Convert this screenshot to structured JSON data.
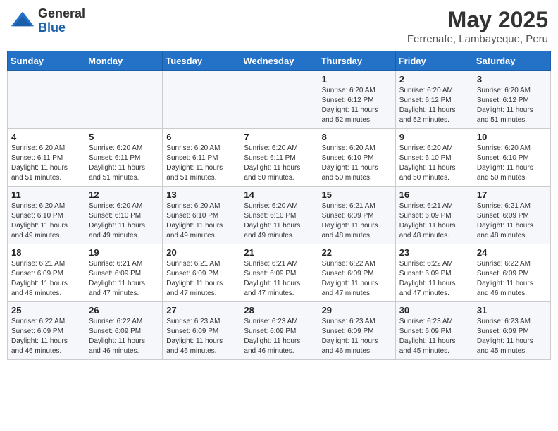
{
  "header": {
    "logo_general": "General",
    "logo_blue": "Blue",
    "month": "May 2025",
    "location": "Ferrenafe, Lambayeque, Peru"
  },
  "weekdays": [
    "Sunday",
    "Monday",
    "Tuesday",
    "Wednesday",
    "Thursday",
    "Friday",
    "Saturday"
  ],
  "weeks": [
    [
      {
        "day": "",
        "info": ""
      },
      {
        "day": "",
        "info": ""
      },
      {
        "day": "",
        "info": ""
      },
      {
        "day": "",
        "info": ""
      },
      {
        "day": "1",
        "info": "Sunrise: 6:20 AM\nSunset: 6:12 PM\nDaylight: 11 hours\nand 52 minutes."
      },
      {
        "day": "2",
        "info": "Sunrise: 6:20 AM\nSunset: 6:12 PM\nDaylight: 11 hours\nand 52 minutes."
      },
      {
        "day": "3",
        "info": "Sunrise: 6:20 AM\nSunset: 6:12 PM\nDaylight: 11 hours\nand 51 minutes."
      }
    ],
    [
      {
        "day": "4",
        "info": "Sunrise: 6:20 AM\nSunset: 6:11 PM\nDaylight: 11 hours\nand 51 minutes."
      },
      {
        "day": "5",
        "info": "Sunrise: 6:20 AM\nSunset: 6:11 PM\nDaylight: 11 hours\nand 51 minutes."
      },
      {
        "day": "6",
        "info": "Sunrise: 6:20 AM\nSunset: 6:11 PM\nDaylight: 11 hours\nand 51 minutes."
      },
      {
        "day": "7",
        "info": "Sunrise: 6:20 AM\nSunset: 6:11 PM\nDaylight: 11 hours\nand 50 minutes."
      },
      {
        "day": "8",
        "info": "Sunrise: 6:20 AM\nSunset: 6:10 PM\nDaylight: 11 hours\nand 50 minutes."
      },
      {
        "day": "9",
        "info": "Sunrise: 6:20 AM\nSunset: 6:10 PM\nDaylight: 11 hours\nand 50 minutes."
      },
      {
        "day": "10",
        "info": "Sunrise: 6:20 AM\nSunset: 6:10 PM\nDaylight: 11 hours\nand 50 minutes."
      }
    ],
    [
      {
        "day": "11",
        "info": "Sunrise: 6:20 AM\nSunset: 6:10 PM\nDaylight: 11 hours\nand 49 minutes."
      },
      {
        "day": "12",
        "info": "Sunrise: 6:20 AM\nSunset: 6:10 PM\nDaylight: 11 hours\nand 49 minutes."
      },
      {
        "day": "13",
        "info": "Sunrise: 6:20 AM\nSunset: 6:10 PM\nDaylight: 11 hours\nand 49 minutes."
      },
      {
        "day": "14",
        "info": "Sunrise: 6:20 AM\nSunset: 6:10 PM\nDaylight: 11 hours\nand 49 minutes."
      },
      {
        "day": "15",
        "info": "Sunrise: 6:21 AM\nSunset: 6:09 PM\nDaylight: 11 hours\nand 48 minutes."
      },
      {
        "day": "16",
        "info": "Sunrise: 6:21 AM\nSunset: 6:09 PM\nDaylight: 11 hours\nand 48 minutes."
      },
      {
        "day": "17",
        "info": "Sunrise: 6:21 AM\nSunset: 6:09 PM\nDaylight: 11 hours\nand 48 minutes."
      }
    ],
    [
      {
        "day": "18",
        "info": "Sunrise: 6:21 AM\nSunset: 6:09 PM\nDaylight: 11 hours\nand 48 minutes."
      },
      {
        "day": "19",
        "info": "Sunrise: 6:21 AM\nSunset: 6:09 PM\nDaylight: 11 hours\nand 47 minutes."
      },
      {
        "day": "20",
        "info": "Sunrise: 6:21 AM\nSunset: 6:09 PM\nDaylight: 11 hours\nand 47 minutes."
      },
      {
        "day": "21",
        "info": "Sunrise: 6:21 AM\nSunset: 6:09 PM\nDaylight: 11 hours\nand 47 minutes."
      },
      {
        "day": "22",
        "info": "Sunrise: 6:22 AM\nSunset: 6:09 PM\nDaylight: 11 hours\nand 47 minutes."
      },
      {
        "day": "23",
        "info": "Sunrise: 6:22 AM\nSunset: 6:09 PM\nDaylight: 11 hours\nand 47 minutes."
      },
      {
        "day": "24",
        "info": "Sunrise: 6:22 AM\nSunset: 6:09 PM\nDaylight: 11 hours\nand 46 minutes."
      }
    ],
    [
      {
        "day": "25",
        "info": "Sunrise: 6:22 AM\nSunset: 6:09 PM\nDaylight: 11 hours\nand 46 minutes."
      },
      {
        "day": "26",
        "info": "Sunrise: 6:22 AM\nSunset: 6:09 PM\nDaylight: 11 hours\nand 46 minutes."
      },
      {
        "day": "27",
        "info": "Sunrise: 6:23 AM\nSunset: 6:09 PM\nDaylight: 11 hours\nand 46 minutes."
      },
      {
        "day": "28",
        "info": "Sunrise: 6:23 AM\nSunset: 6:09 PM\nDaylight: 11 hours\nand 46 minutes."
      },
      {
        "day": "29",
        "info": "Sunrise: 6:23 AM\nSunset: 6:09 PM\nDaylight: 11 hours\nand 46 minutes."
      },
      {
        "day": "30",
        "info": "Sunrise: 6:23 AM\nSunset: 6:09 PM\nDaylight: 11 hours\nand 45 minutes."
      },
      {
        "day": "31",
        "info": "Sunrise: 6:23 AM\nSunset: 6:09 PM\nDaylight: 11 hours\nand 45 minutes."
      }
    ]
  ]
}
